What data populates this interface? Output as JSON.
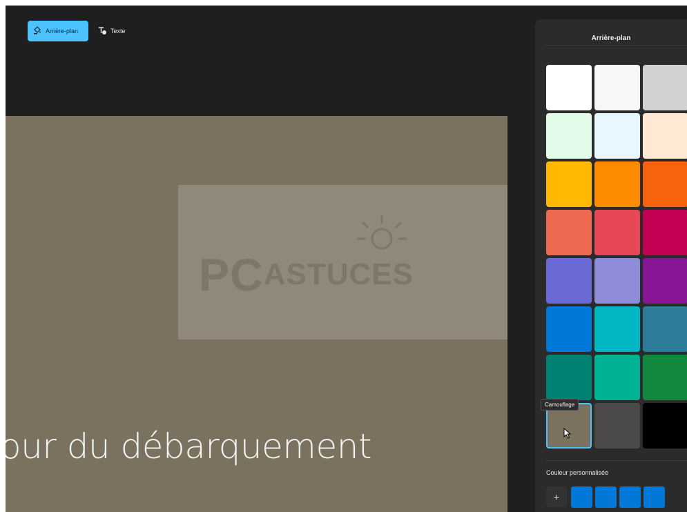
{
  "toolbar": {
    "background_label": "Arrière-plan",
    "text_label": "Texte"
  },
  "canvas": {
    "caption": "our du débarquement",
    "watermark_pc": "PC",
    "watermark_astuces": "ASTUCES",
    "background_color": "#7a715e"
  },
  "panel": {
    "title": "Arrière-plan",
    "swatches": [
      {
        "color": "#ffffff"
      },
      {
        "color": "#f7f7f7"
      },
      {
        "color": "#d2d2d2"
      },
      {
        "color": "#e3fbe9"
      },
      {
        "color": "#e8f6fd"
      },
      {
        "color": "#ffe9d4"
      },
      {
        "color": "#ffb900"
      },
      {
        "color": "#ff8c00"
      },
      {
        "color": "#f7630c"
      },
      {
        "color": "#ef6950"
      },
      {
        "color": "#e74856"
      },
      {
        "color": "#c30052"
      },
      {
        "color": "#6b69d6"
      },
      {
        "color": "#8e8cd8"
      },
      {
        "color": "#881798"
      },
      {
        "color": "#0078d7"
      },
      {
        "color": "#00b7c3"
      },
      {
        "color": "#2d7d9a"
      },
      {
        "color": "#008272"
      },
      {
        "color": "#00b294"
      },
      {
        "color": "#10893e"
      },
      {
        "color": "#7a715e",
        "name": "Camouflage",
        "selected": true
      },
      {
        "color": "#4c4a48"
      },
      {
        "color": "#000000"
      }
    ],
    "tooltip": "Camouflage",
    "custom_label": "Couleur personnalisée",
    "add_symbol": "+",
    "custom_colors": [
      "#0078d7",
      "#0078d7",
      "#0078d7",
      "#0078d7"
    ]
  }
}
